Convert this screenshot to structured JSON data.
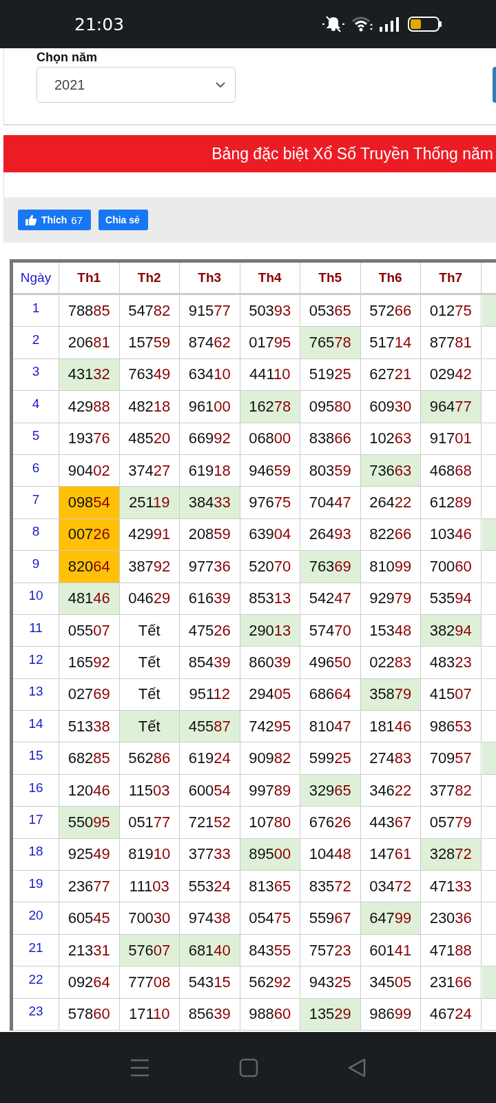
{
  "status_bar": {
    "time": "21:03"
  },
  "year_picker": {
    "label": "Chọn năm",
    "value": "2021"
  },
  "banner": {
    "title": "Bảng đặc biệt Xổ Số Truyền Thống năm"
  },
  "social": {
    "like_label": "Thích",
    "like_count": "67",
    "share_label": "Chia sẻ"
  },
  "table": {
    "columns": [
      "Ngày",
      "Th1",
      "Th2",
      "Th3",
      "Th4",
      "Th5",
      "Th6",
      "Th7"
    ],
    "rows": [
      {
        "edge_highlighted": true,
        "cells": [
          {
            "kind": "day",
            "text": "1"
          },
          {
            "kind": "number",
            "lead": "788",
            "tail": "85"
          },
          {
            "kind": "number",
            "lead": "547",
            "tail": "82"
          },
          {
            "kind": "number",
            "lead": "915",
            "tail": "77"
          },
          {
            "kind": "number",
            "lead": "503",
            "tail": "93"
          },
          {
            "kind": "number",
            "lead": "053",
            "tail": "65"
          },
          {
            "kind": "number",
            "lead": "572",
            "tail": "66"
          },
          {
            "kind": "number",
            "lead": "012",
            "tail": "75"
          }
        ]
      },
      {
        "edge_highlighted": false,
        "cells": [
          {
            "kind": "day",
            "text": "2"
          },
          {
            "kind": "number",
            "lead": "206",
            "tail": "81"
          },
          {
            "kind": "number",
            "lead": "157",
            "tail": "59"
          },
          {
            "kind": "number",
            "lead": "874",
            "tail": "62"
          },
          {
            "kind": "number",
            "lead": "017",
            "tail": "95"
          },
          {
            "kind": "number",
            "lead": "765",
            "tail": "78",
            "color": "#dff0d8"
          },
          {
            "kind": "number",
            "lead": "517",
            "tail": "14"
          },
          {
            "kind": "number",
            "lead": "877",
            "tail": "81"
          }
        ]
      },
      {
        "edge_highlighted": false,
        "cells": [
          {
            "kind": "day",
            "text": "3"
          },
          {
            "kind": "number",
            "lead": "431",
            "tail": "32",
            "color": "#dff0d8"
          },
          {
            "kind": "number",
            "lead": "763",
            "tail": "49"
          },
          {
            "kind": "number",
            "lead": "634",
            "tail": "10"
          },
          {
            "kind": "number",
            "lead": "441",
            "tail": "10"
          },
          {
            "kind": "number",
            "lead": "519",
            "tail": "25"
          },
          {
            "kind": "number",
            "lead": "627",
            "tail": "21"
          },
          {
            "kind": "number",
            "lead": "029",
            "tail": "42"
          }
        ]
      },
      {
        "edge_highlighted": false,
        "cells": [
          {
            "kind": "day",
            "text": "4"
          },
          {
            "kind": "number",
            "lead": "429",
            "tail": "88"
          },
          {
            "kind": "number",
            "lead": "482",
            "tail": "18"
          },
          {
            "kind": "number",
            "lead": "961",
            "tail": "00"
          },
          {
            "kind": "number",
            "lead": "162",
            "tail": "78",
            "color": "#dff0d8"
          },
          {
            "kind": "number",
            "lead": "095",
            "tail": "80"
          },
          {
            "kind": "number",
            "lead": "609",
            "tail": "30"
          },
          {
            "kind": "number",
            "lead": "964",
            "tail": "77",
            "color": "#dff0d8"
          }
        ]
      },
      {
        "edge_highlighted": false,
        "cells": [
          {
            "kind": "day",
            "text": "5"
          },
          {
            "kind": "number",
            "lead": "193",
            "tail": "76"
          },
          {
            "kind": "number",
            "lead": "485",
            "tail": "20"
          },
          {
            "kind": "number",
            "lead": "669",
            "tail": "92"
          },
          {
            "kind": "number",
            "lead": "068",
            "tail": "00"
          },
          {
            "kind": "number",
            "lead": "838",
            "tail": "66"
          },
          {
            "kind": "number",
            "lead": "102",
            "tail": "63"
          },
          {
            "kind": "number",
            "lead": "917",
            "tail": "01"
          }
        ]
      },
      {
        "edge_highlighted": false,
        "cells": [
          {
            "kind": "day",
            "text": "6"
          },
          {
            "kind": "number",
            "lead": "904",
            "tail": "02"
          },
          {
            "kind": "number",
            "lead": "374",
            "tail": "27"
          },
          {
            "kind": "number",
            "lead": "619",
            "tail": "18"
          },
          {
            "kind": "number",
            "lead": "946",
            "tail": "59"
          },
          {
            "kind": "number",
            "lead": "803",
            "tail": "59"
          },
          {
            "kind": "number",
            "lead": "736",
            "tail": "63",
            "color": "#dff0d8"
          },
          {
            "kind": "number",
            "lead": "468",
            "tail": "68"
          }
        ]
      },
      {
        "edge_highlighted": false,
        "cells": [
          {
            "kind": "day",
            "text": "7"
          },
          {
            "kind": "number",
            "lead": "098",
            "tail": "54",
            "color": "#ffc107"
          },
          {
            "kind": "number",
            "lead": "251",
            "tail": "19",
            "color": "#dff0d8"
          },
          {
            "kind": "number",
            "lead": "384",
            "tail": "33",
            "color": "#dff0d8"
          },
          {
            "kind": "number",
            "lead": "976",
            "tail": "75"
          },
          {
            "kind": "number",
            "lead": "704",
            "tail": "47"
          },
          {
            "kind": "number",
            "lead": "264",
            "tail": "22"
          },
          {
            "kind": "number",
            "lead": "612",
            "tail": "89"
          }
        ]
      },
      {
        "edge_highlighted": true,
        "cells": [
          {
            "kind": "day",
            "text": "8"
          },
          {
            "kind": "number",
            "lead": "007",
            "tail": "26",
            "color": "#ffc107"
          },
          {
            "kind": "number",
            "lead": "429",
            "tail": "91"
          },
          {
            "kind": "number",
            "lead": "208",
            "tail": "59"
          },
          {
            "kind": "number",
            "lead": "639",
            "tail": "04"
          },
          {
            "kind": "number",
            "lead": "264",
            "tail": "93"
          },
          {
            "kind": "number",
            "lead": "822",
            "tail": "66"
          },
          {
            "kind": "number",
            "lead": "103",
            "tail": "46"
          }
        ]
      },
      {
        "edge_highlighted": false,
        "cells": [
          {
            "kind": "day",
            "text": "9"
          },
          {
            "kind": "number",
            "lead": "820",
            "tail": "64",
            "color": "#ffc107"
          },
          {
            "kind": "number",
            "lead": "387",
            "tail": "92"
          },
          {
            "kind": "number",
            "lead": "977",
            "tail": "36"
          },
          {
            "kind": "number",
            "lead": "520",
            "tail": "70"
          },
          {
            "kind": "number",
            "lead": "763",
            "tail": "69",
            "color": "#dff0d8"
          },
          {
            "kind": "number",
            "lead": "810",
            "tail": "99"
          },
          {
            "kind": "number",
            "lead": "700",
            "tail": "60"
          }
        ]
      },
      {
        "edge_highlighted": false,
        "cells": [
          {
            "kind": "day",
            "text": "10"
          },
          {
            "kind": "number",
            "lead": "481",
            "tail": "46",
            "color": "#dff0d8"
          },
          {
            "kind": "number",
            "lead": "046",
            "tail": "29"
          },
          {
            "kind": "number",
            "lead": "616",
            "tail": "39"
          },
          {
            "kind": "number",
            "lead": "853",
            "tail": "13"
          },
          {
            "kind": "number",
            "lead": "542",
            "tail": "47"
          },
          {
            "kind": "number",
            "lead": "929",
            "tail": "79"
          },
          {
            "kind": "number",
            "lead": "535",
            "tail": "94"
          }
        ]
      },
      {
        "edge_highlighted": false,
        "cells": [
          {
            "kind": "day",
            "text": "11"
          },
          {
            "kind": "number",
            "lead": "055",
            "tail": "07"
          },
          {
            "kind": "holiday",
            "text": "Tết"
          },
          {
            "kind": "number",
            "lead": "475",
            "tail": "26"
          },
          {
            "kind": "number",
            "lead": "290",
            "tail": "13",
            "color": "#dff0d8"
          },
          {
            "kind": "number",
            "lead": "574",
            "tail": "70"
          },
          {
            "kind": "number",
            "lead": "153",
            "tail": "48"
          },
          {
            "kind": "number",
            "lead": "382",
            "tail": "94",
            "color": "#dff0d8"
          }
        ]
      },
      {
        "edge_highlighted": false,
        "cells": [
          {
            "kind": "day",
            "text": "12"
          },
          {
            "kind": "number",
            "lead": "165",
            "tail": "92"
          },
          {
            "kind": "holiday",
            "text": "Tết"
          },
          {
            "kind": "number",
            "lead": "854",
            "tail": "39"
          },
          {
            "kind": "number",
            "lead": "860",
            "tail": "39"
          },
          {
            "kind": "number",
            "lead": "496",
            "tail": "50"
          },
          {
            "kind": "number",
            "lead": "022",
            "tail": "83"
          },
          {
            "kind": "number",
            "lead": "483",
            "tail": "23"
          }
        ]
      },
      {
        "edge_highlighted": false,
        "cells": [
          {
            "kind": "day",
            "text": "13"
          },
          {
            "kind": "number",
            "lead": "027",
            "tail": "69"
          },
          {
            "kind": "holiday",
            "text": "Tết"
          },
          {
            "kind": "number",
            "lead": "951",
            "tail": "12"
          },
          {
            "kind": "number",
            "lead": "294",
            "tail": "05"
          },
          {
            "kind": "number",
            "lead": "686",
            "tail": "64"
          },
          {
            "kind": "number",
            "lead": "358",
            "tail": "79",
            "color": "#dff0d8"
          },
          {
            "kind": "number",
            "lead": "415",
            "tail": "07"
          }
        ]
      },
      {
        "edge_highlighted": false,
        "cells": [
          {
            "kind": "day",
            "text": "14"
          },
          {
            "kind": "number",
            "lead": "513",
            "tail": "38"
          },
          {
            "kind": "holiday",
            "text": "Tết",
            "color": "#dff0d8"
          },
          {
            "kind": "number",
            "lead": "455",
            "tail": "87",
            "color": "#dff0d8"
          },
          {
            "kind": "number",
            "lead": "742",
            "tail": "95"
          },
          {
            "kind": "number",
            "lead": "810",
            "tail": "47"
          },
          {
            "kind": "number",
            "lead": "181",
            "tail": "46"
          },
          {
            "kind": "number",
            "lead": "986",
            "tail": "53"
          }
        ]
      },
      {
        "edge_highlighted": true,
        "cells": [
          {
            "kind": "day",
            "text": "15"
          },
          {
            "kind": "number",
            "lead": "682",
            "tail": "85"
          },
          {
            "kind": "number",
            "lead": "562",
            "tail": "86"
          },
          {
            "kind": "number",
            "lead": "619",
            "tail": "24"
          },
          {
            "kind": "number",
            "lead": "909",
            "tail": "82"
          },
          {
            "kind": "number",
            "lead": "599",
            "tail": "25"
          },
          {
            "kind": "number",
            "lead": "274",
            "tail": "83"
          },
          {
            "kind": "number",
            "lead": "709",
            "tail": "57"
          }
        ]
      },
      {
        "edge_highlighted": false,
        "cells": [
          {
            "kind": "day",
            "text": "16"
          },
          {
            "kind": "number",
            "lead": "120",
            "tail": "46"
          },
          {
            "kind": "number",
            "lead": "115",
            "tail": "03"
          },
          {
            "kind": "number",
            "lead": "600",
            "tail": "54"
          },
          {
            "kind": "number",
            "lead": "997",
            "tail": "89"
          },
          {
            "kind": "number",
            "lead": "329",
            "tail": "65",
            "color": "#dff0d8"
          },
          {
            "kind": "number",
            "lead": "346",
            "tail": "22"
          },
          {
            "kind": "number",
            "lead": "377",
            "tail": "82"
          }
        ]
      },
      {
        "edge_highlighted": false,
        "cells": [
          {
            "kind": "day",
            "text": "17"
          },
          {
            "kind": "number",
            "lead": "550",
            "tail": "95",
            "color": "#dff0d8"
          },
          {
            "kind": "number",
            "lead": "051",
            "tail": "77"
          },
          {
            "kind": "number",
            "lead": "721",
            "tail": "52"
          },
          {
            "kind": "number",
            "lead": "107",
            "tail": "80"
          },
          {
            "kind": "number",
            "lead": "676",
            "tail": "26"
          },
          {
            "kind": "number",
            "lead": "443",
            "tail": "67"
          },
          {
            "kind": "number",
            "lead": "057",
            "tail": "79"
          }
        ]
      },
      {
        "edge_highlighted": false,
        "cells": [
          {
            "kind": "day",
            "text": "18"
          },
          {
            "kind": "number",
            "lead": "925",
            "tail": "49"
          },
          {
            "kind": "number",
            "lead": "819",
            "tail": "10"
          },
          {
            "kind": "number",
            "lead": "377",
            "tail": "33"
          },
          {
            "kind": "number",
            "lead": "895",
            "tail": "00",
            "color": "#dff0d8"
          },
          {
            "kind": "number",
            "lead": "104",
            "tail": "48"
          },
          {
            "kind": "number",
            "lead": "147",
            "tail": "61"
          },
          {
            "kind": "number",
            "lead": "328",
            "tail": "72",
            "color": "#dff0d8"
          }
        ]
      },
      {
        "edge_highlighted": false,
        "cells": [
          {
            "kind": "day",
            "text": "19"
          },
          {
            "kind": "number",
            "lead": "236",
            "tail": "77"
          },
          {
            "kind": "number",
            "lead": "111",
            "tail": "03"
          },
          {
            "kind": "number",
            "lead": "553",
            "tail": "24"
          },
          {
            "kind": "number",
            "lead": "813",
            "tail": "65"
          },
          {
            "kind": "number",
            "lead": "835",
            "tail": "72"
          },
          {
            "kind": "number",
            "lead": "034",
            "tail": "72"
          },
          {
            "kind": "number",
            "lead": "471",
            "tail": "33"
          }
        ]
      },
      {
        "edge_highlighted": false,
        "cells": [
          {
            "kind": "day",
            "text": "20"
          },
          {
            "kind": "number",
            "lead": "605",
            "tail": "45"
          },
          {
            "kind": "number",
            "lead": "700",
            "tail": "30"
          },
          {
            "kind": "number",
            "lead": "974",
            "tail": "38"
          },
          {
            "kind": "number",
            "lead": "054",
            "tail": "75"
          },
          {
            "kind": "number",
            "lead": "559",
            "tail": "67"
          },
          {
            "kind": "number",
            "lead": "647",
            "tail": "99",
            "color": "#dff0d8"
          },
          {
            "kind": "number",
            "lead": "230",
            "tail": "36"
          }
        ]
      },
      {
        "edge_highlighted": false,
        "cells": [
          {
            "kind": "day",
            "text": "21"
          },
          {
            "kind": "number",
            "lead": "213",
            "tail": "31"
          },
          {
            "kind": "number",
            "lead": "576",
            "tail": "07",
            "color": "#dff0d8"
          },
          {
            "kind": "number",
            "lead": "681",
            "tail": "40",
            "color": "#dff0d8"
          },
          {
            "kind": "number",
            "lead": "843",
            "tail": "55"
          },
          {
            "kind": "number",
            "lead": "757",
            "tail": "23"
          },
          {
            "kind": "number",
            "lead": "601",
            "tail": "41"
          },
          {
            "kind": "number",
            "lead": "471",
            "tail": "88"
          }
        ]
      },
      {
        "edge_highlighted": true,
        "cells": [
          {
            "kind": "day",
            "text": "22"
          },
          {
            "kind": "number",
            "lead": "092",
            "tail": "64"
          },
          {
            "kind": "number",
            "lead": "777",
            "tail": "08"
          },
          {
            "kind": "number",
            "lead": "543",
            "tail": "15"
          },
          {
            "kind": "number",
            "lead": "562",
            "tail": "92"
          },
          {
            "kind": "number",
            "lead": "943",
            "tail": "25"
          },
          {
            "kind": "number",
            "lead": "345",
            "tail": "05"
          },
          {
            "kind": "number",
            "lead": "231",
            "tail": "66"
          }
        ]
      },
      {
        "edge_highlighted": false,
        "cells": [
          {
            "kind": "day",
            "text": "23"
          },
          {
            "kind": "number",
            "lead": "578",
            "tail": "60"
          },
          {
            "kind": "number",
            "lead": "171",
            "tail": "10"
          },
          {
            "kind": "number",
            "lead": "856",
            "tail": "39"
          },
          {
            "kind": "number",
            "lead": "988",
            "tail": "60"
          },
          {
            "kind": "number",
            "lead": "135",
            "tail": "29",
            "color": "#dff0d8"
          },
          {
            "kind": "number",
            "lead": "986",
            "tail": "99"
          },
          {
            "kind": "number",
            "lead": "467",
            "tail": "24"
          }
        ]
      }
    ]
  }
}
